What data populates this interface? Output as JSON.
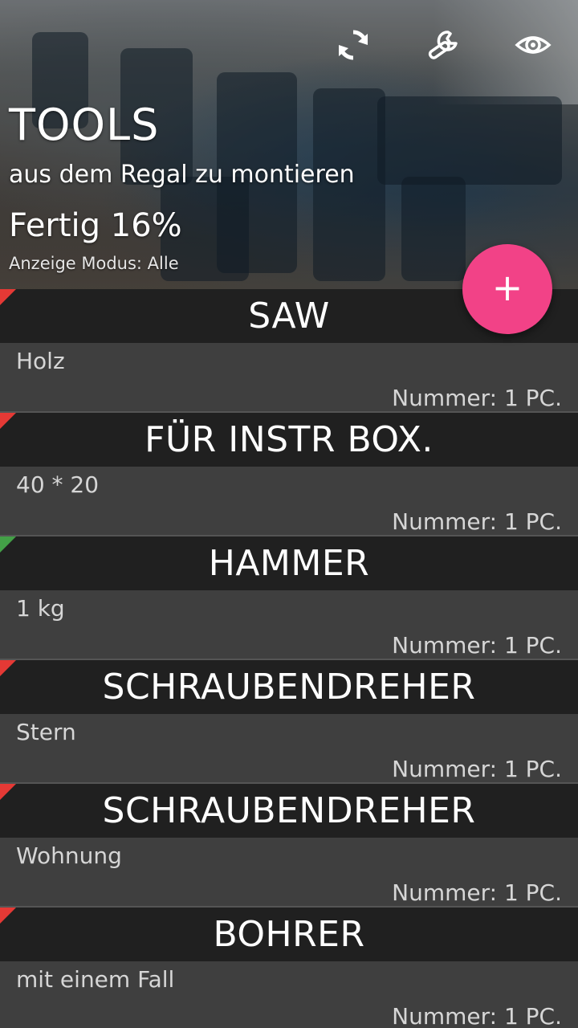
{
  "header": {
    "title": "TOOLS",
    "subtitle": "aus dem Regal zu montieren",
    "progress": "Fertig 16%",
    "mode": "Anzeige Modus: Alle",
    "icons": [
      "refresh-icon",
      "wrench-icon",
      "eye-icon"
    ]
  },
  "fab": {
    "label": "+"
  },
  "colors": {
    "accent": "#f24287",
    "status_open": "#e53935",
    "status_done": "#43a047",
    "item_header_bg": "#202020",
    "item_body_bg": "#3f3f3f"
  },
  "items": [
    {
      "title": "SAW",
      "desc": "Holz",
      "qty": "Nummer: 1 PC.",
      "status": "open"
    },
    {
      "title": "FÜR INSTR BOX.",
      "desc": "40 * 20",
      "qty": "Nummer: 1 PC.",
      "status": "open"
    },
    {
      "title": "HAMMER",
      "desc": "1 kg",
      "qty": "Nummer: 1 PC.",
      "status": "done"
    },
    {
      "title": "SCHRAUBENDREHER",
      "desc": "Stern",
      "qty": "Nummer: 1 PC.",
      "status": "open"
    },
    {
      "title": "SCHRAUBENDREHER",
      "desc": "Wohnung",
      "qty": "Nummer: 1 PC.",
      "status": "open"
    },
    {
      "title": "BOHRER",
      "desc": "mit einem Fall",
      "qty": "Nummer: 1 PC.",
      "status": "open"
    }
  ]
}
